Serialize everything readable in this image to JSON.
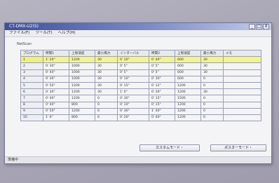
{
  "window": {
    "title": "CT-DMX-U2(S)",
    "controls": [
      "_",
      "□",
      "X"
    ]
  },
  "menu": [
    "ファイル(F)",
    "ツール(T)",
    "ヘルプ(H)"
  ],
  "section_label": "NetScan",
  "table": {
    "columns": [
      "プログラム",
      "時間1",
      "上限速度",
      "最小風力",
      "インターバル",
      "時間2",
      "上限速度",
      "最小風力",
      "メモ"
    ],
    "selected_row": 0,
    "rows": [
      [
        "1",
        "1' 20\"",
        "1200",
        "30",
        "0' 10\"",
        "0' 40\"",
        "600",
        "30",
        ""
      ],
      [
        "2",
        "0' 30\"",
        "1000",
        "30",
        "0' 5\"",
        "0' 5\"",
        "600",
        "30",
        ""
      ],
      [
        "3",
        "0' 40\"",
        "1000",
        "30",
        "0' 5\"",
        "0' 5\"",
        "600",
        "30",
        ""
      ],
      [
        "4",
        "0' 30\"",
        "1000",
        "30",
        "0' 10\"",
        "0' 30\"",
        "600",
        "0",
        ""
      ],
      [
        "5",
        "0' 50\"",
        "1200",
        "30",
        "0' 15\"",
        "0' 12\"",
        "1200",
        "0",
        ""
      ],
      [
        "6",
        "0' 30\"",
        "1200",
        "30",
        "1' 0\"",
        "0' 30\"",
        "1200",
        "30",
        ""
      ],
      [
        "7",
        "0' 40\"",
        "1200",
        "0",
        "0' 30\"",
        "0' 15\"",
        "1500",
        "0",
        ""
      ],
      [
        "8",
        "0' 40\"",
        "800",
        "0",
        "0' 10\"",
        "0' 15\"",
        "1200",
        "0",
        ""
      ],
      [
        "9",
        "0' 50\"",
        "1200",
        "0",
        "0' 30\"",
        "1' 40\"",
        "1200",
        "0",
        ""
      ],
      [
        "10",
        "1' 0\"",
        "800",
        "0",
        "0' 20\"",
        "0' 40\"",
        "1200",
        "0",
        ""
      ]
    ]
  },
  "buttons": {
    "left": "カスタムモード・",
    "right": "ポスターモード・"
  },
  "status": "準備中"
}
